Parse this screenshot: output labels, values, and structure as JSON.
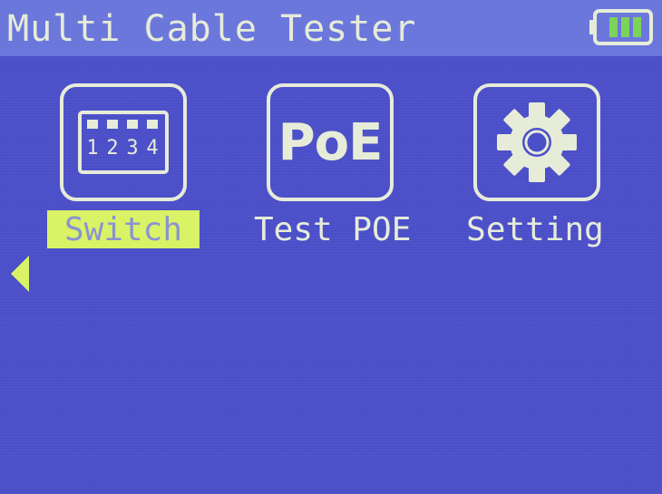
{
  "header": {
    "title": "Multi Cable Tester"
  },
  "battery": {
    "icon": "battery-icon",
    "level_bars": 3,
    "fill_color": "#7bd35a"
  },
  "menu": {
    "items": [
      {
        "label": "Switch",
        "icon": "switch-ports-icon",
        "ports": [
          "1",
          "2",
          "3",
          "4"
        ],
        "selected": true
      },
      {
        "label": "Test POE",
        "icon": "poe-icon",
        "icon_text": "PoE",
        "selected": false
      },
      {
        "label": "Setting",
        "icon": "gear-icon",
        "selected": false
      }
    ]
  },
  "nav": {
    "left_icon": "left-arrow-icon"
  },
  "colors": {
    "background": "#4b4fc8",
    "header": "#6c77dc",
    "foreground": "#e6ecd8",
    "highlight": "#d9f266"
  }
}
